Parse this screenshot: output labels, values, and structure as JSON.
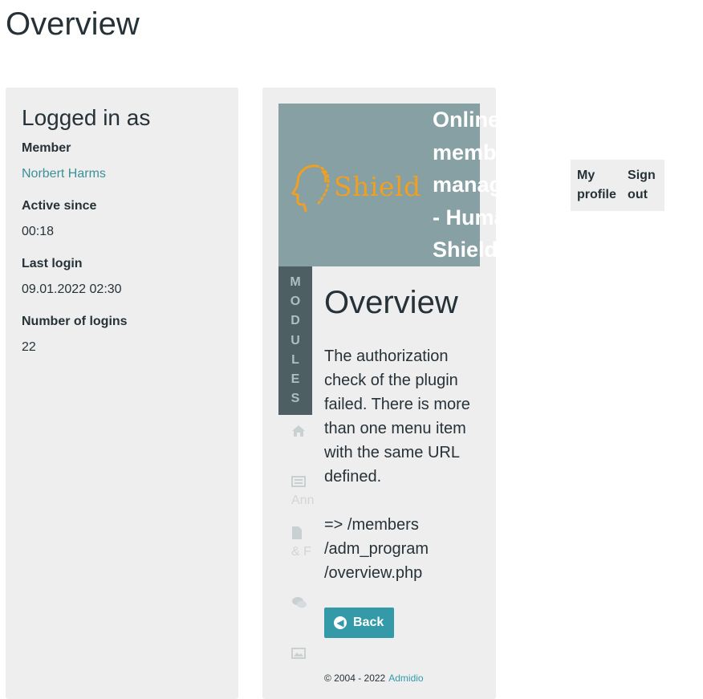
{
  "page_title": "Overview",
  "user_panel": {
    "heading": "Logged in as",
    "member_label": "Member",
    "member_value": "Norbert Harms",
    "active_since_label": "Active since",
    "active_since_value": "00:18",
    "last_login_label": "Last login",
    "last_login_value": "09.01.2022 02:30",
    "logins_label": "Number of logins",
    "logins_value": "22"
  },
  "header": {
    "logo_text": "Shield",
    "title_lines": [
      "Online",
      "membership",
      "management",
      "- Human",
      "Shield"
    ]
  },
  "modules": {
    "tab_letters": [
      "M",
      "O",
      "D",
      "U",
      "L",
      "E",
      "S"
    ],
    "icons": [
      "home-icon",
      "announcements-icon",
      "documents-icon",
      "forum-icon",
      "photos-icon"
    ],
    "labels": [
      "Ann",
      "& F"
    ]
  },
  "main": {
    "title": "Overview",
    "message": "The authorization check of the plugin failed. There is more than one menu item with the same URL defined.",
    "url_line": "=> /members /adm_program /overview.php",
    "back_button": "Back",
    "footer_text": "© 2004 - 2022",
    "footer_link": "Admidio"
  },
  "top_nav": {
    "my_profile": "My profile",
    "sign_out": "Sign out"
  },
  "colors": {
    "accent": "#349aa8",
    "banner": "#86a0a4",
    "modules_tab": "#4e5f63",
    "logo": "#f0a020",
    "panel": "#eeeeee"
  }
}
